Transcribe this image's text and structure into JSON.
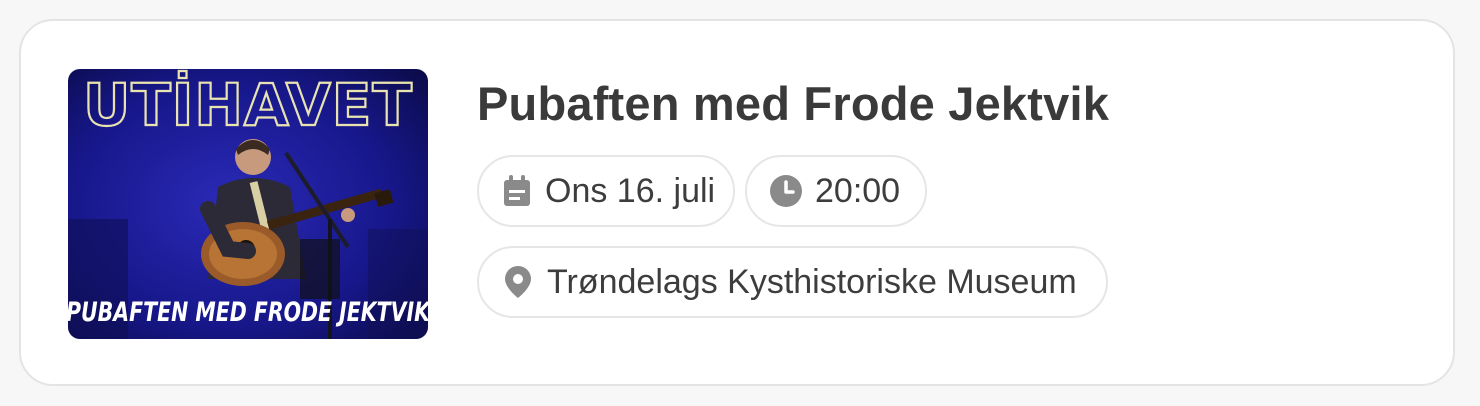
{
  "event": {
    "title": "Pubaften med Frode Jektvik",
    "date": "Ons 16. juli",
    "time": "20:00",
    "location": "Trøndelags Kysthistoriske Museum"
  },
  "thumbnail": {
    "logo_text": "UTİHAVET",
    "caption_text": "PUBAFTEN MED FRODE JEKTVIK"
  },
  "icons": {
    "date": "calendar-icon",
    "time": "clock-icon",
    "location": "location-pin-icon"
  },
  "colors": {
    "title": "#3a3a3a",
    "icon": "#8a8a8a",
    "thumbnail_bg": "#1a1a8c"
  }
}
